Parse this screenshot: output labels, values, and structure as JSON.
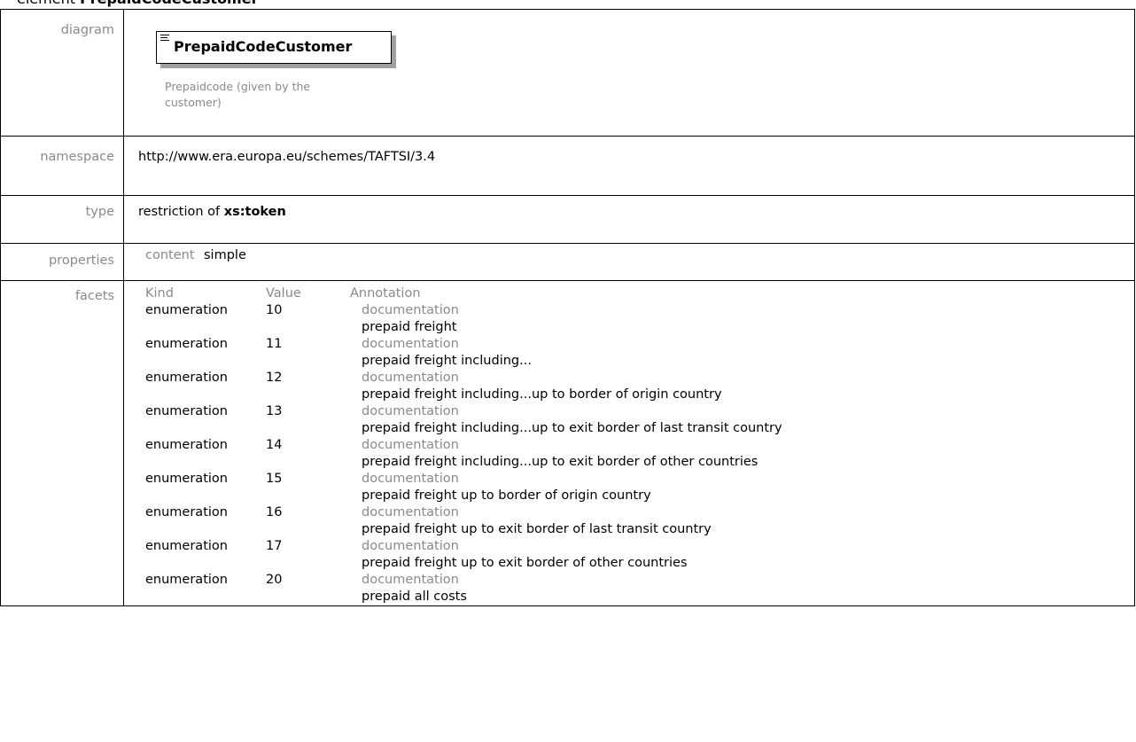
{
  "heading": {
    "prefix": "element ",
    "name": "PrepaidCodeCustomer"
  },
  "rows": {
    "diagram": {
      "label": "diagram",
      "element_name": "PrepaidCodeCustomer",
      "caption": "Prepaidcode (given by the customer)"
    },
    "namespace": {
      "label": "namespace",
      "value": "http://www.era.europa.eu/schemes/TAFTSI/3.4"
    },
    "type": {
      "label": "type",
      "prefix": "restriction of ",
      "base": "xs:token"
    },
    "properties": {
      "label": "properties",
      "key": "content",
      "value": "simple"
    },
    "facets": {
      "label": "facets",
      "headers": {
        "kind": "Kind",
        "value": "Value",
        "annotation": "Annotation"
      },
      "items": [
        {
          "kind": "enumeration",
          "value": "10",
          "doc_label": "documentation",
          "doc": "prepaid freight"
        },
        {
          "kind": "enumeration",
          "value": "11",
          "doc_label": "documentation",
          "doc": "prepaid freight including..."
        },
        {
          "kind": "enumeration",
          "value": "12",
          "doc_label": "documentation",
          "doc": "prepaid freight including...up to border of origin country"
        },
        {
          "kind": "enumeration",
          "value": "13",
          "doc_label": "documentation",
          "doc": "prepaid freight including...up to exit border of last transit country"
        },
        {
          "kind": "enumeration",
          "value": "14",
          "doc_label": "documentation",
          "doc": "prepaid freight including...up to exit border of other countries"
        },
        {
          "kind": "enumeration",
          "value": "15",
          "doc_label": "documentation",
          "doc": "prepaid freight up to border of origin country"
        },
        {
          "kind": "enumeration",
          "value": "16",
          "doc_label": "documentation",
          "doc": "prepaid freight up to exit border of last transit country"
        },
        {
          "kind": "enumeration",
          "value": "17",
          "doc_label": "documentation",
          "doc": "prepaid freight up to exit border of other countries"
        },
        {
          "kind": "enumeration",
          "value": "20",
          "doc_label": "documentation",
          "doc": "prepaid all costs"
        }
      ]
    }
  }
}
